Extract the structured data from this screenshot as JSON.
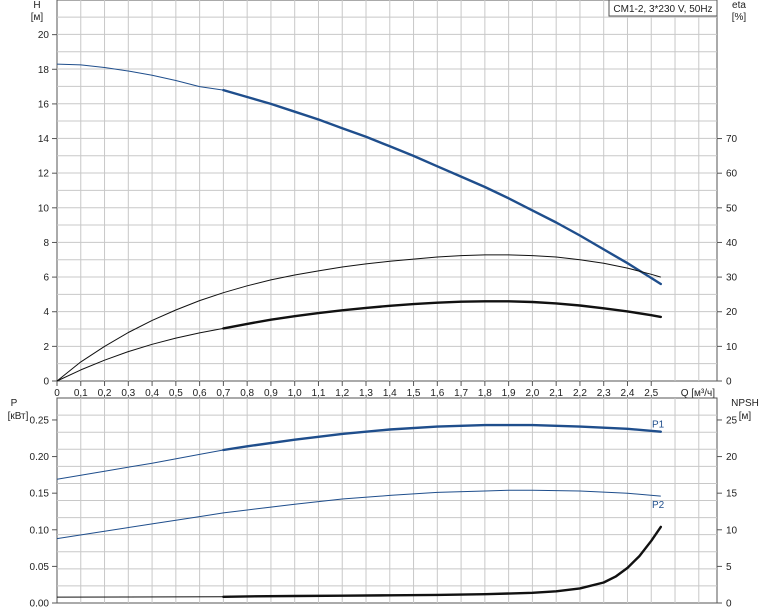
{
  "chart_data": [
    {
      "type": "line",
      "title": "CM1-2, 3*230 V, 50Hz",
      "x_label": "Q [м³/ч]",
      "x_ticks": [
        "0",
        "0,1",
        "0,2",
        "0,3",
        "0,4",
        "0,5",
        "0,6",
        "0,7",
        "0,8",
        "0,9",
        "1,0",
        "1,1",
        "1,2",
        "1,3",
        "1,4",
        "1,5",
        "1,6",
        "1,7",
        "1,8",
        "1,9",
        "2,0",
        "2,1",
        "2,2",
        "2,3",
        "2,4",
        "2,5"
      ],
      "xlim": [
        0,
        2.7
      ],
      "y_left": {
        "name": "H",
        "unit": "[м]",
        "ticks": [
          "0",
          "2",
          "4",
          "6",
          "8",
          "10",
          "12",
          "14",
          "16",
          "18",
          "20"
        ],
        "ylim": [
          0,
          22
        ]
      },
      "y_right": {
        "name": "eta",
        "unit": "[%]",
        "ticks": [
          "0",
          "10",
          "20",
          "30",
          "40",
          "50",
          "60",
          "70"
        ],
        "ylim": [
          0,
          110
        ]
      },
      "grid": true,
      "series": [
        {
          "axis": "left",
          "color": "#1f4e8c",
          "x": [
            0,
            0.1,
            0.2,
            0.3,
            0.4,
            0.5,
            0.6,
            0.7,
            0.8,
            0.9,
            1.0,
            1.1,
            1.2,
            1.3,
            1.4,
            1.5,
            1.6,
            1.7,
            1.8,
            1.9,
            2.0,
            2.1,
            2.2,
            2.3,
            2.4,
            2.5,
            2.54
          ],
          "y": [
            18.3,
            18.25,
            18.1,
            17.9,
            17.65,
            17.35,
            17.0,
            16.8,
            16.4,
            16.0,
            15.55,
            15.1,
            14.6,
            14.1,
            13.55,
            13.0,
            12.4,
            11.8,
            11.2,
            10.55,
            9.85,
            9.15,
            8.4,
            7.6,
            6.8,
            5.95,
            5.6
          ],
          "bold_from": 0.7
        },
        {
          "axis": "right",
          "color": "#111111",
          "x": [
            0,
            0.1,
            0.2,
            0.3,
            0.4,
            0.5,
            0.6,
            0.7,
            0.8,
            0.9,
            1.0,
            1.1,
            1.2,
            1.3,
            1.4,
            1.5,
            1.6,
            1.7,
            1.8,
            1.9,
            2.0,
            2.1,
            2.2,
            2.3,
            2.4,
            2.5,
            2.54
          ],
          "y": [
            0,
            5.5,
            10,
            14,
            17.5,
            20.5,
            23.2,
            25.5,
            27.5,
            29.2,
            30.6,
            31.8,
            32.9,
            33.8,
            34.6,
            35.2,
            35.8,
            36.2,
            36.4,
            36.4,
            36.2,
            35.8,
            35.0,
            34.0,
            32.6,
            30.8,
            30.0
          ],
          "bold_from": null
        },
        {
          "axis": "right",
          "color": "#111111",
          "x": [
            0,
            0.1,
            0.2,
            0.3,
            0.4,
            0.5,
            0.6,
            0.7,
            0.8,
            0.9,
            1.0,
            1.1,
            1.2,
            1.3,
            1.4,
            1.5,
            1.6,
            1.7,
            1.8,
            1.9,
            2.0,
            2.1,
            2.2,
            2.3,
            2.4,
            2.5,
            2.54
          ],
          "y": [
            0,
            3.2,
            6.0,
            8.5,
            10.6,
            12.4,
            13.9,
            15.2,
            16.5,
            17.7,
            18.7,
            19.6,
            20.4,
            21.1,
            21.7,
            22.2,
            22.6,
            22.9,
            23.0,
            23.0,
            22.8,
            22.4,
            21.8,
            21.0,
            20.1,
            19.0,
            18.5
          ],
          "bold_from": 0.7
        }
      ]
    },
    {
      "type": "line",
      "x_ticks": [],
      "xlim": [
        0,
        2.7
      ],
      "y_left": {
        "name": "P",
        "unit": "[кВт]",
        "ticks": [
          "0.00",
          "0.05",
          "0.10",
          "0.15",
          "0.20",
          "0.25"
        ],
        "ylim": [
          0,
          0.28
        ]
      },
      "y_right": {
        "name": "NPSH",
        "unit": "[м]",
        "ticks": [
          "0",
          "5",
          "10",
          "15",
          "20",
          "25"
        ],
        "ylim": [
          0,
          28
        ]
      },
      "grid": true,
      "series": [
        {
          "name": "P1",
          "axis": "left",
          "color": "#1f4e8c",
          "x": [
            0,
            0.2,
            0.4,
            0.6,
            0.7,
            0.8,
            1.0,
            1.2,
            1.4,
            1.6,
            1.8,
            1.9,
            2.0,
            2.2,
            2.4,
            2.54
          ],
          "y": [
            0.169,
            0.18,
            0.191,
            0.203,
            0.209,
            0.214,
            0.223,
            0.231,
            0.237,
            0.241,
            0.243,
            0.243,
            0.243,
            0.241,
            0.238,
            0.234
          ],
          "bold_from": 0.7
        },
        {
          "name": "P2",
          "axis": "left",
          "color": "#1f4e8c",
          "x": [
            0,
            0.2,
            0.4,
            0.6,
            0.7,
            0.8,
            1.0,
            1.2,
            1.4,
            1.6,
            1.8,
            1.9,
            2.0,
            2.2,
            2.4,
            2.54
          ],
          "y": [
            0.088,
            0.098,
            0.108,
            0.118,
            0.123,
            0.127,
            0.135,
            0.142,
            0.147,
            0.151,
            0.153,
            0.154,
            0.154,
            0.153,
            0.15,
            0.146
          ],
          "bold_from": null
        },
        {
          "axis": "right",
          "color": "#111111",
          "x": [
            0,
            0.7,
            0.8,
            1.0,
            1.2,
            1.4,
            1.6,
            1.8,
            2.0,
            2.1,
            2.2,
            2.3,
            2.35,
            2.4,
            2.45,
            2.5,
            2.54
          ],
          "y": [
            0.8,
            0.85,
            0.9,
            0.95,
            1.0,
            1.05,
            1.1,
            1.2,
            1.4,
            1.6,
            2.0,
            2.8,
            3.6,
            4.8,
            6.4,
            8.5,
            10.4
          ],
          "bold_from": 0.7
        }
      ]
    }
  ]
}
